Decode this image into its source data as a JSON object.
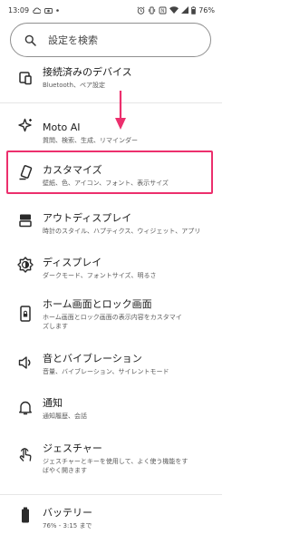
{
  "status_bar": {
    "time": "13:09",
    "battery": "76%"
  },
  "search": {
    "placeholder": "設定を検索"
  },
  "items": [
    {
      "title": "接続済みのデバイス",
      "subtitle": "Bluetooth、ペア設定"
    },
    {
      "title": "Moto AI",
      "subtitle": "質問、検索、生成、リマインダー"
    },
    {
      "title": "カスタマイズ",
      "subtitle": "壁紙、色、アイコン、フォント、表示サイズ"
    },
    {
      "title": "アウトディスプレイ",
      "subtitle": "時計のスタイル、ハプティクス、ウィジェット、アプリ"
    },
    {
      "title": "ディスプレイ",
      "subtitle": "ダークモード、フォントサイズ、明るさ"
    },
    {
      "title": "ホーム画面とロック画面",
      "subtitle": "ホーム画面とロック画面の表示内容をカスタマイズします"
    },
    {
      "title": "音とバイブレーション",
      "subtitle": "音量、バイブレーション、サイレントモード"
    },
    {
      "title": "通知",
      "subtitle": "通知履歴、会話"
    },
    {
      "title": "ジェスチャー",
      "subtitle": "ジェスチャーとキーを使用して、よく使う機能をすばやく開きます"
    },
    {
      "title": "バッテリー",
      "subtitle": "76% - 3:15 まで"
    }
  ],
  "colors": {
    "highlight": "#ec2f6d",
    "arrow": "#ec2f6d"
  }
}
